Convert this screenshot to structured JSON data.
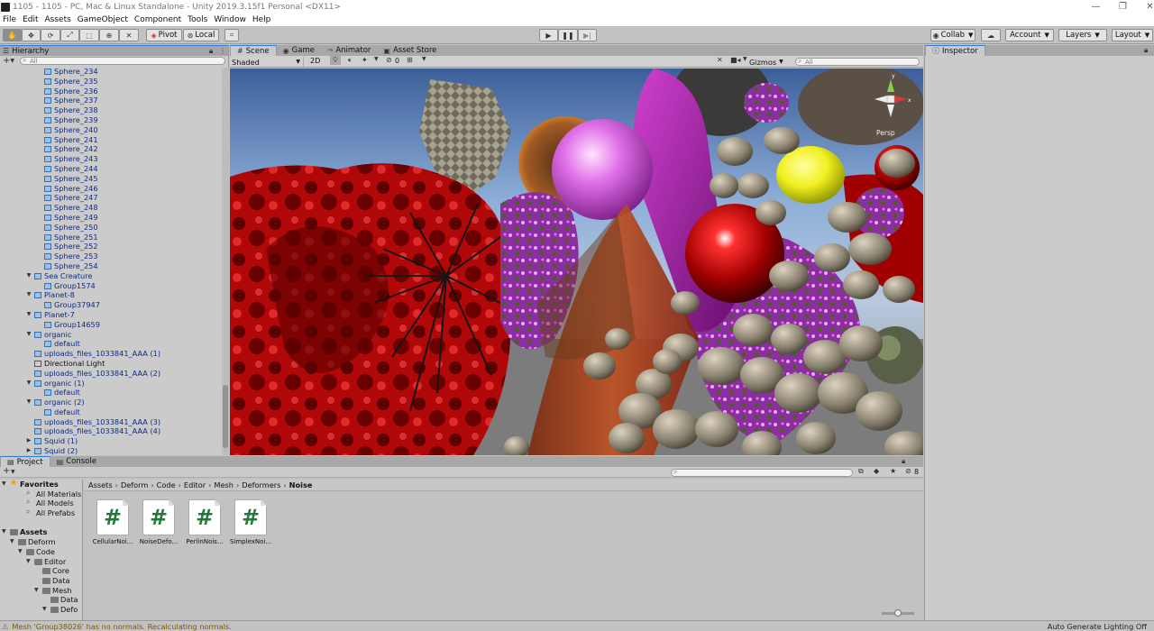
{
  "window": {
    "title": "1105 - 1105 - PC, Mac & Linux Standalone - Unity 2019.3.15f1 Personal <DX11>",
    "controls": [
      "—",
      "❐",
      "✕"
    ]
  },
  "menu": [
    "File",
    "Edit",
    "Assets",
    "GameObject",
    "Component",
    "Tools",
    "Window",
    "Help"
  ],
  "toolbar": {
    "pivot": "Pivot",
    "local": "Local",
    "collab": "Collab",
    "account": "Account",
    "layers": "Layers",
    "layout": "Layout"
  },
  "hierarchy": {
    "tab": "Hierarchy",
    "search_placeholder": "All",
    "rows": [
      {
        "label": "Sphere_234",
        "indent": 2,
        "arrow": "",
        "color": "blue"
      },
      {
        "label": "Sphere_235",
        "indent": 2,
        "arrow": "",
        "color": "blue"
      },
      {
        "label": "Sphere_236",
        "indent": 2,
        "arrow": "",
        "color": "blue"
      },
      {
        "label": "Sphere_237",
        "indent": 2,
        "arrow": "",
        "color": "blue"
      },
      {
        "label": "Sphere_238",
        "indent": 2,
        "arrow": "",
        "color": "blue"
      },
      {
        "label": "Sphere_239",
        "indent": 2,
        "arrow": "",
        "color": "blue"
      },
      {
        "label": "Sphere_240",
        "indent": 2,
        "arrow": "",
        "color": "blue"
      },
      {
        "label": "Sphere_241",
        "indent": 2,
        "arrow": "",
        "color": "blue"
      },
      {
        "label": "Sphere_242",
        "indent": 2,
        "arrow": "",
        "color": "blue"
      },
      {
        "label": "Sphere_243",
        "indent": 2,
        "arrow": "",
        "color": "blue"
      },
      {
        "label": "Sphere_244",
        "indent": 2,
        "arrow": "",
        "color": "blue"
      },
      {
        "label": "Sphere_245",
        "indent": 2,
        "arrow": "",
        "color": "blue"
      },
      {
        "label": "Sphere_246",
        "indent": 2,
        "arrow": "",
        "color": "blue"
      },
      {
        "label": "Sphere_247",
        "indent": 2,
        "arrow": "",
        "color": "blue"
      },
      {
        "label": "Sphere_248",
        "indent": 2,
        "arrow": "",
        "color": "blue"
      },
      {
        "label": "Sphere_249",
        "indent": 2,
        "arrow": "",
        "color": "blue"
      },
      {
        "label": "Sphere_250",
        "indent": 2,
        "arrow": "",
        "color": "blue"
      },
      {
        "label": "Sphere_251",
        "indent": 2,
        "arrow": "",
        "color": "blue"
      },
      {
        "label": "Sphere_252",
        "indent": 2,
        "arrow": "",
        "color": "blue"
      },
      {
        "label": "Sphere_253",
        "indent": 2,
        "arrow": "",
        "color": "blue"
      },
      {
        "label": "Sphere_254",
        "indent": 2,
        "arrow": "",
        "color": "blue"
      },
      {
        "label": "Sea Creature",
        "indent": 1,
        "arrow": "▼",
        "color": "blue"
      },
      {
        "label": "Group1574",
        "indent": 2,
        "arrow": "",
        "color": "blue"
      },
      {
        "label": "Planet-8",
        "indent": 1,
        "arrow": "▼",
        "color": "blue"
      },
      {
        "label": "Group37947",
        "indent": 2,
        "arrow": "",
        "color": "blue"
      },
      {
        "label": "Planet-7",
        "indent": 1,
        "arrow": "▼",
        "color": "blue"
      },
      {
        "label": "Group14659",
        "indent": 2,
        "arrow": "",
        "color": "blue"
      },
      {
        "label": "organic",
        "indent": 1,
        "arrow": "▼",
        "color": "blue"
      },
      {
        "label": "default",
        "indent": 2,
        "arrow": "",
        "color": "blue"
      },
      {
        "label": "uploads_files_1033841_AAA (1)",
        "indent": 1,
        "arrow": "",
        "color": "blue"
      },
      {
        "label": "Directional Light",
        "indent": 1,
        "arrow": "",
        "color": "black"
      },
      {
        "label": "uploads_files_1033841_AAA (2)",
        "indent": 1,
        "arrow": "",
        "color": "blue"
      },
      {
        "label": "organic (1)",
        "indent": 1,
        "arrow": "▼",
        "color": "blue"
      },
      {
        "label": "default",
        "indent": 2,
        "arrow": "",
        "color": "blue"
      },
      {
        "label": "organic (2)",
        "indent": 1,
        "arrow": "▼",
        "color": "blue"
      },
      {
        "label": "default",
        "indent": 2,
        "arrow": "",
        "color": "blue"
      },
      {
        "label": "uploads_files_1033841_AAA (3)",
        "indent": 1,
        "arrow": "",
        "color": "blue"
      },
      {
        "label": "uploads_files_1033841_AAA (4)",
        "indent": 1,
        "arrow": "",
        "color": "blue"
      },
      {
        "label": "Squid (1)",
        "indent": 1,
        "arrow": "▶",
        "color": "blue"
      },
      {
        "label": "Squid (2)",
        "indent": 1,
        "arrow": "▶",
        "color": "blue"
      }
    ]
  },
  "scene": {
    "tabs": [
      {
        "label": "Scene",
        "icon": "#",
        "active": true
      },
      {
        "label": "Game",
        "icon": "◉",
        "active": false
      },
      {
        "label": "Animator",
        "icon": "⤳",
        "active": false
      },
      {
        "label": "Asset Store",
        "icon": "▣",
        "active": false
      }
    ],
    "shading_mode": "Shaded",
    "mode_2d": "2D",
    "hidden_count": "0",
    "gizmos_label": "Gizmos",
    "search_placeholder": "All",
    "persp_label": "Persp",
    "axis_labels": {
      "x": "x",
      "y": "y"
    }
  },
  "inspector": {
    "tab": "Inspector"
  },
  "project": {
    "tabs": [
      {
        "label": "Project",
        "icon": "▤",
        "active": true
      },
      {
        "label": "Console",
        "icon": "▤",
        "active": false
      }
    ],
    "hidden_count": "8",
    "tree": [
      {
        "label": "Favorites",
        "indent": 0,
        "kind": "star",
        "arrow": "▼",
        "bold": true
      },
      {
        "label": "All Materials",
        "indent": 2,
        "kind": "search",
        "arrow": "",
        "bold": false
      },
      {
        "label": "All Models",
        "indent": 2,
        "kind": "search",
        "arrow": "",
        "bold": false
      },
      {
        "label": "All Prefabs",
        "indent": 2,
        "kind": "search",
        "arrow": "",
        "bold": false
      },
      {
        "label": "",
        "indent": 0,
        "kind": "blank",
        "arrow": "",
        "bold": false
      },
      {
        "label": "Assets",
        "indent": 0,
        "kind": "folder",
        "arrow": "▼",
        "bold": true
      },
      {
        "label": "Deform",
        "indent": 1,
        "kind": "folder",
        "arrow": "▼",
        "bold": false
      },
      {
        "label": "Code",
        "indent": 2,
        "kind": "folder",
        "arrow": "▼",
        "bold": false
      },
      {
        "label": "Editor",
        "indent": 3,
        "kind": "folder",
        "arrow": "▼",
        "bold": false
      },
      {
        "label": "Core",
        "indent": 4,
        "kind": "folder",
        "arrow": "",
        "bold": false
      },
      {
        "label": "Data",
        "indent": 4,
        "kind": "folder",
        "arrow": "",
        "bold": false
      },
      {
        "label": "Mesh",
        "indent": 4,
        "kind": "folder",
        "arrow": "▼",
        "bold": false
      },
      {
        "label": "Data",
        "indent": 5,
        "kind": "folder",
        "arrow": "",
        "bold": false
      },
      {
        "label": "Defo",
        "indent": 5,
        "kind": "folder",
        "arrow": "▼",
        "bold": false
      }
    ],
    "breadcrumbs": [
      "Assets",
      "Deform",
      "Code",
      "Editor",
      "Mesh",
      "Deformers",
      "Noise"
    ],
    "assets": [
      {
        "name": "CellularNoi...",
        "glyph": "#"
      },
      {
        "name": "NoiseDefo...",
        "glyph": "#"
      },
      {
        "name": "PerlinNois...",
        "glyph": "#"
      },
      {
        "name": "SimplexNoi...",
        "glyph": "#"
      }
    ]
  },
  "status": {
    "message": "Mesh 'Group38026' has no normals. Recalculating normals.",
    "right": "Auto Generate Lighting Off"
  },
  "colors": {
    "accent": "#2f7de0",
    "hierarchy_blue": "#0d2b86",
    "script_green": "#1f7a3a",
    "warning": "#8a6d00"
  }
}
